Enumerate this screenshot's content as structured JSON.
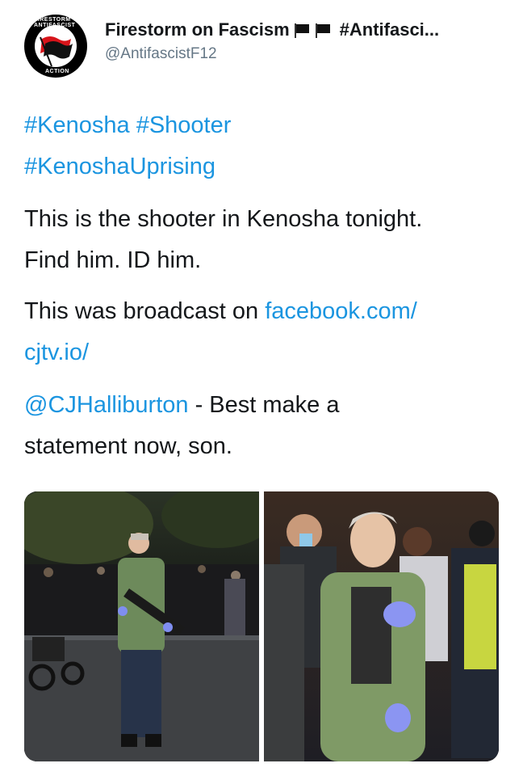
{
  "user": {
    "display_name": "Firestorm on Fascism",
    "name_suffix": "#Antifasci...",
    "handle": "@AntifascistF12",
    "avatar_text_top": "FIRESTORM ANTIFASCIST",
    "avatar_text_bottom": "ACTION"
  },
  "tweet": {
    "hashtag_1": "#Kenosha",
    "hashtag_2": "#Shooter",
    "hashtag_3": "#KenoshaUprising",
    "line_1": "This is the shooter in Kenosha tonight.",
    "line_2": "Find him. ID him.",
    "broadcast_prefix": "This was broadcast on ",
    "link_part_1": "facebook.com/",
    "link_part_2": "cjtv.io/",
    "mention": "@CJHalliburton",
    "mention_suffix": " - Best make a",
    "closing_line": "statement now, son."
  },
  "colors": {
    "link": "#1b95e0",
    "text": "#14171a",
    "secondary": "#657786"
  }
}
